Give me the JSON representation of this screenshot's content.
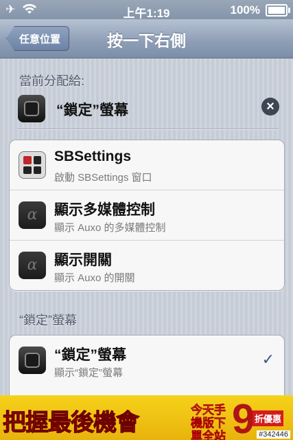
{
  "status_bar": {
    "time": "上午1:19",
    "battery": "100%",
    "icons": [
      "airplane-icon",
      "wifi-icon",
      "battery-icon"
    ]
  },
  "nav": {
    "back_label": "任意位置",
    "title": "按一下右側"
  },
  "current": {
    "section_label": "當前分配給:",
    "assigned_label": "“鎖定”螢幕",
    "remove_icon": "remove-icon"
  },
  "actions": [
    {
      "title": "SBSettings",
      "subtitle": "啟動 SBSettings 窗口",
      "icon": "sbsettings-icon"
    },
    {
      "title": "顯示多媒體控制",
      "subtitle": "顯示 Auxo 的多媒體控制",
      "icon": "auxo-icon"
    },
    {
      "title": "顯示開關",
      "subtitle": "顯示 Auxo 的開關",
      "icon": "auxo-icon"
    }
  ],
  "lock_section": {
    "label": "“鎖定”螢幕",
    "items": [
      {
        "title": "“鎖定”螢幕",
        "subtitle": "顯示“鎖定”螢幕",
        "selected": true,
        "icon": "lock-screen-icon"
      }
    ]
  },
  "ad": {
    "main_text": "把握最後機會",
    "sub_text": "今天手機版下單全站",
    "number": "9",
    "tag": "折優惠",
    "id": "#342446"
  },
  "colors": {
    "nav_bar": "#8d9db5",
    "checkmark": "#38568a",
    "ad_background": "#f6d21a"
  }
}
